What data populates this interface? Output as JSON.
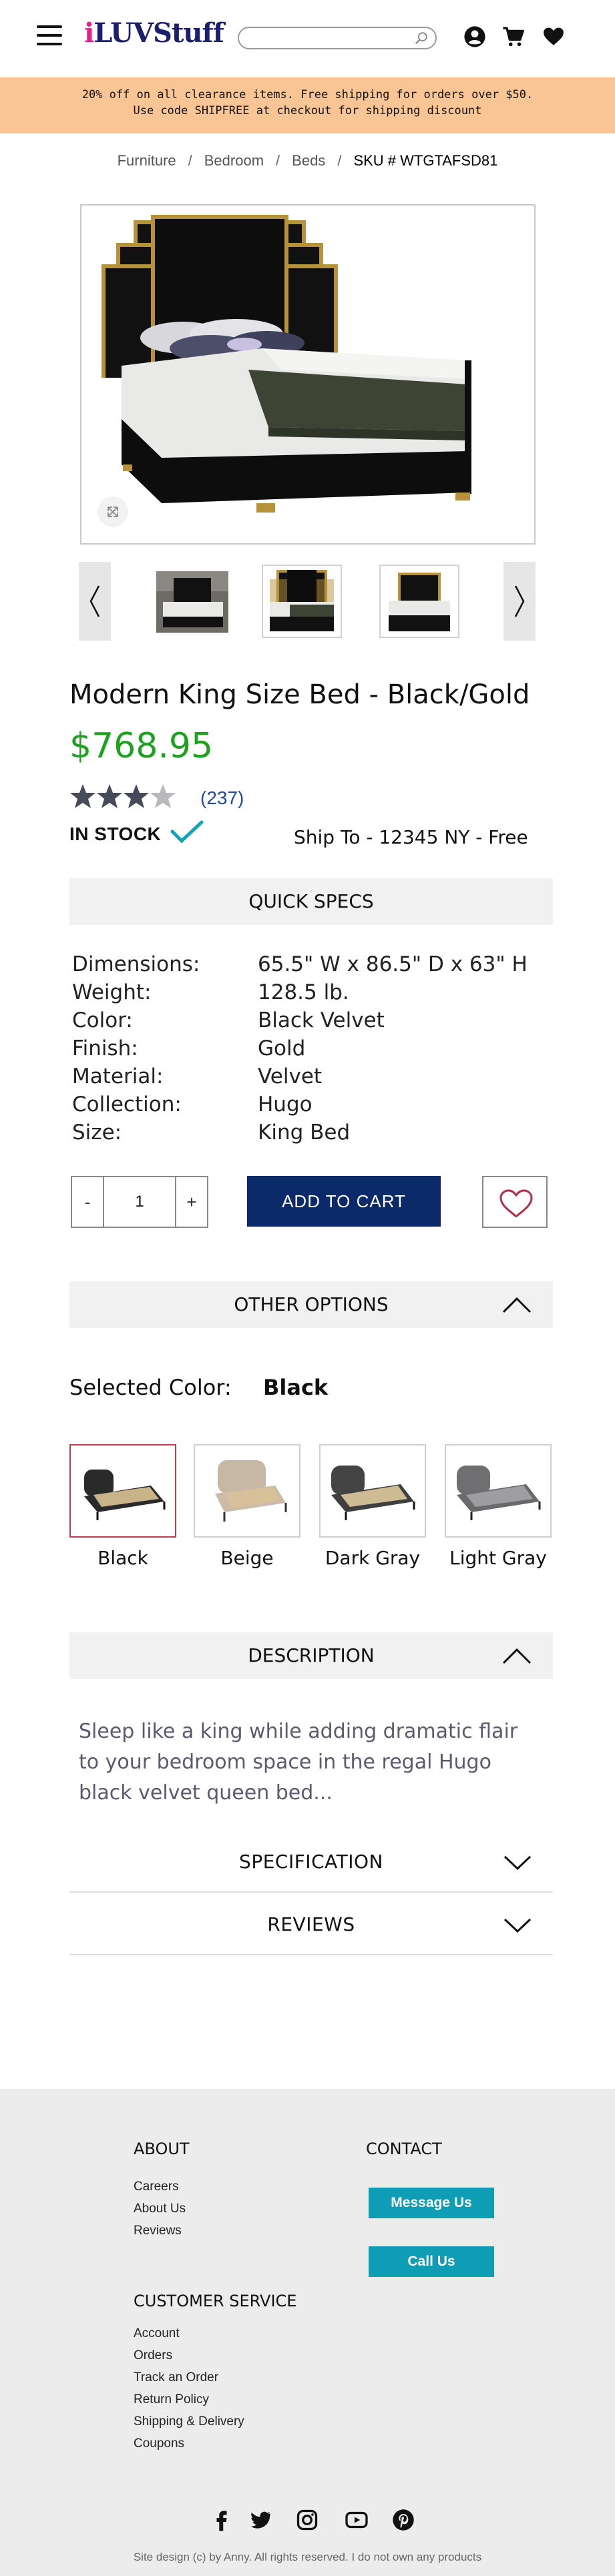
{
  "header": {
    "logo_i": "i",
    "logo_rest": "LUVStuff",
    "search_placeholder": ""
  },
  "promo": {
    "line1": "20% off on all clearance items. Free shipping for orders over $50.",
    "line2": "Use code SHIPFREE at checkout for shipping discount"
  },
  "breadcrumb": {
    "items": [
      "Furniture",
      "Bedroom",
      "Beds"
    ],
    "separator": "/",
    "sku": "SKU # WTGTAFSD81"
  },
  "product": {
    "title": "Modern King Size Bed - Black/Gold",
    "price": "$768.95",
    "rating": 3,
    "rating_max": 5,
    "review_count": "(237)",
    "stock": "IN STOCK",
    "ship_to": "Ship To - 12345 NY - Free"
  },
  "quick_specs": {
    "heading": "QUICK SPECS",
    "rows": [
      {
        "k": "Dimensions:",
        "v": "65.5\" W x 86.5\" D x 63\" H"
      },
      {
        "k": "Weight:",
        "v": "128.5 lb."
      },
      {
        "k": "Color:",
        "v": "Black Velvet"
      },
      {
        "k": "Finish:",
        "v": "Gold"
      },
      {
        "k": "Material:",
        "v": "Velvet"
      },
      {
        "k": "Collection:",
        "v": "Hugo"
      },
      {
        "k": "Size:",
        "v": "King Bed"
      }
    ]
  },
  "cart": {
    "minus": "-",
    "qty": "1",
    "plus": "+",
    "add_label": "ADD TO CART"
  },
  "options": {
    "heading": "OTHER OPTIONS",
    "selected_label": "Selected Color:",
    "selected_value": "Black",
    "colors": [
      "Black",
      "Beige",
      "Dark Gray",
      "Light Gray"
    ]
  },
  "description": {
    "heading": "DESCRIPTION",
    "text": "Sleep like a king while adding dramatic flair to your bedroom space in the regal Hugo black velvet queen bed..."
  },
  "accordions": {
    "spec": "SPECIFICATION",
    "reviews": "REVIEWS"
  },
  "footer": {
    "about_heading": "ABOUT",
    "about_links": [
      "Careers",
      "About Us",
      "Reviews"
    ],
    "contact_heading": "CONTACT",
    "message_btn": "Message Us",
    "call_btn": "Call Us",
    "service_heading": "CUSTOMER SERVICE",
    "service_links": [
      "Account",
      "Orders",
      "Track an Order",
      "Return Policy",
      "Shipping & Delivery",
      "Coupons"
    ],
    "credit": "Site design (c) by Anny. All rights reserved. I do not own any products"
  },
  "colors": {
    "price_green": "#1ea11e",
    "promo_bg": "#f9c594",
    "cart_navy": "#0a2a6a",
    "contact_teal": "#0f9db5",
    "active_swatch": "#c43a4e"
  },
  "icons": [
    "menu-icon",
    "search-icon",
    "user-icon",
    "cart-icon",
    "heart-icon",
    "expand-icon",
    "chevron-left-icon",
    "chevron-right-icon",
    "star-icon",
    "check-icon",
    "chevron-up-icon",
    "chevron-down-icon",
    "facebook-icon",
    "twitter-icon",
    "instagram-icon",
    "youtube-icon",
    "pinterest-icon"
  ]
}
